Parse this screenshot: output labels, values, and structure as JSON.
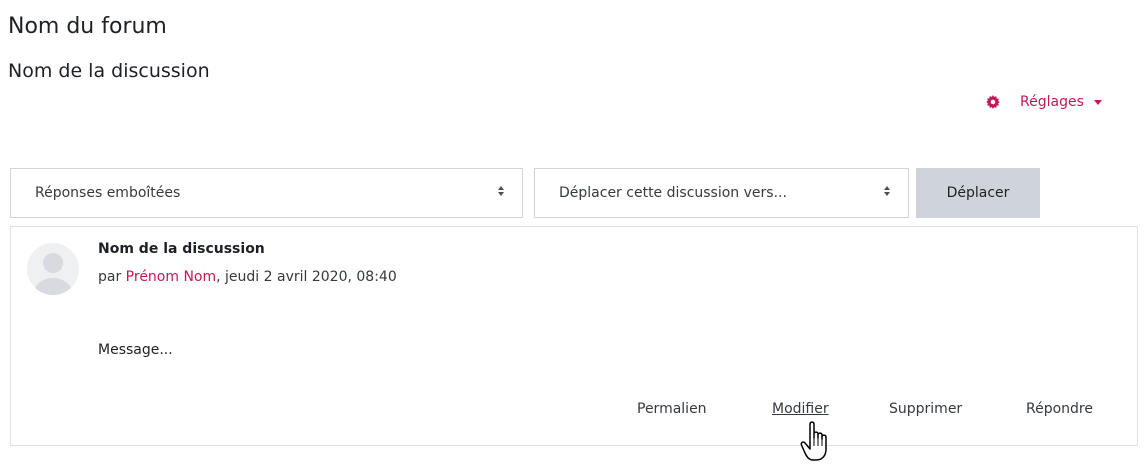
{
  "page": {
    "forum_title": "Nom du forum",
    "discussion_title": "Nom de la discussion"
  },
  "settings": {
    "label": "Réglages",
    "icon": "gear-icon",
    "color": "#c2185b"
  },
  "controls": {
    "display_mode": "Réponses emboîtées",
    "move_select": "Déplacer cette discussion vers...",
    "move_button": "Déplacer"
  },
  "post": {
    "subject": "Nom de la discussion",
    "byline_prefix": "par ",
    "author": "Prénom Nom",
    "date": ", jeudi 2 avril 2020, 08:40",
    "message": "Message...",
    "actions": {
      "permalink": "Permalien",
      "edit": "Modifier",
      "delete": "Supprimer",
      "reply": "Répondre"
    }
  }
}
